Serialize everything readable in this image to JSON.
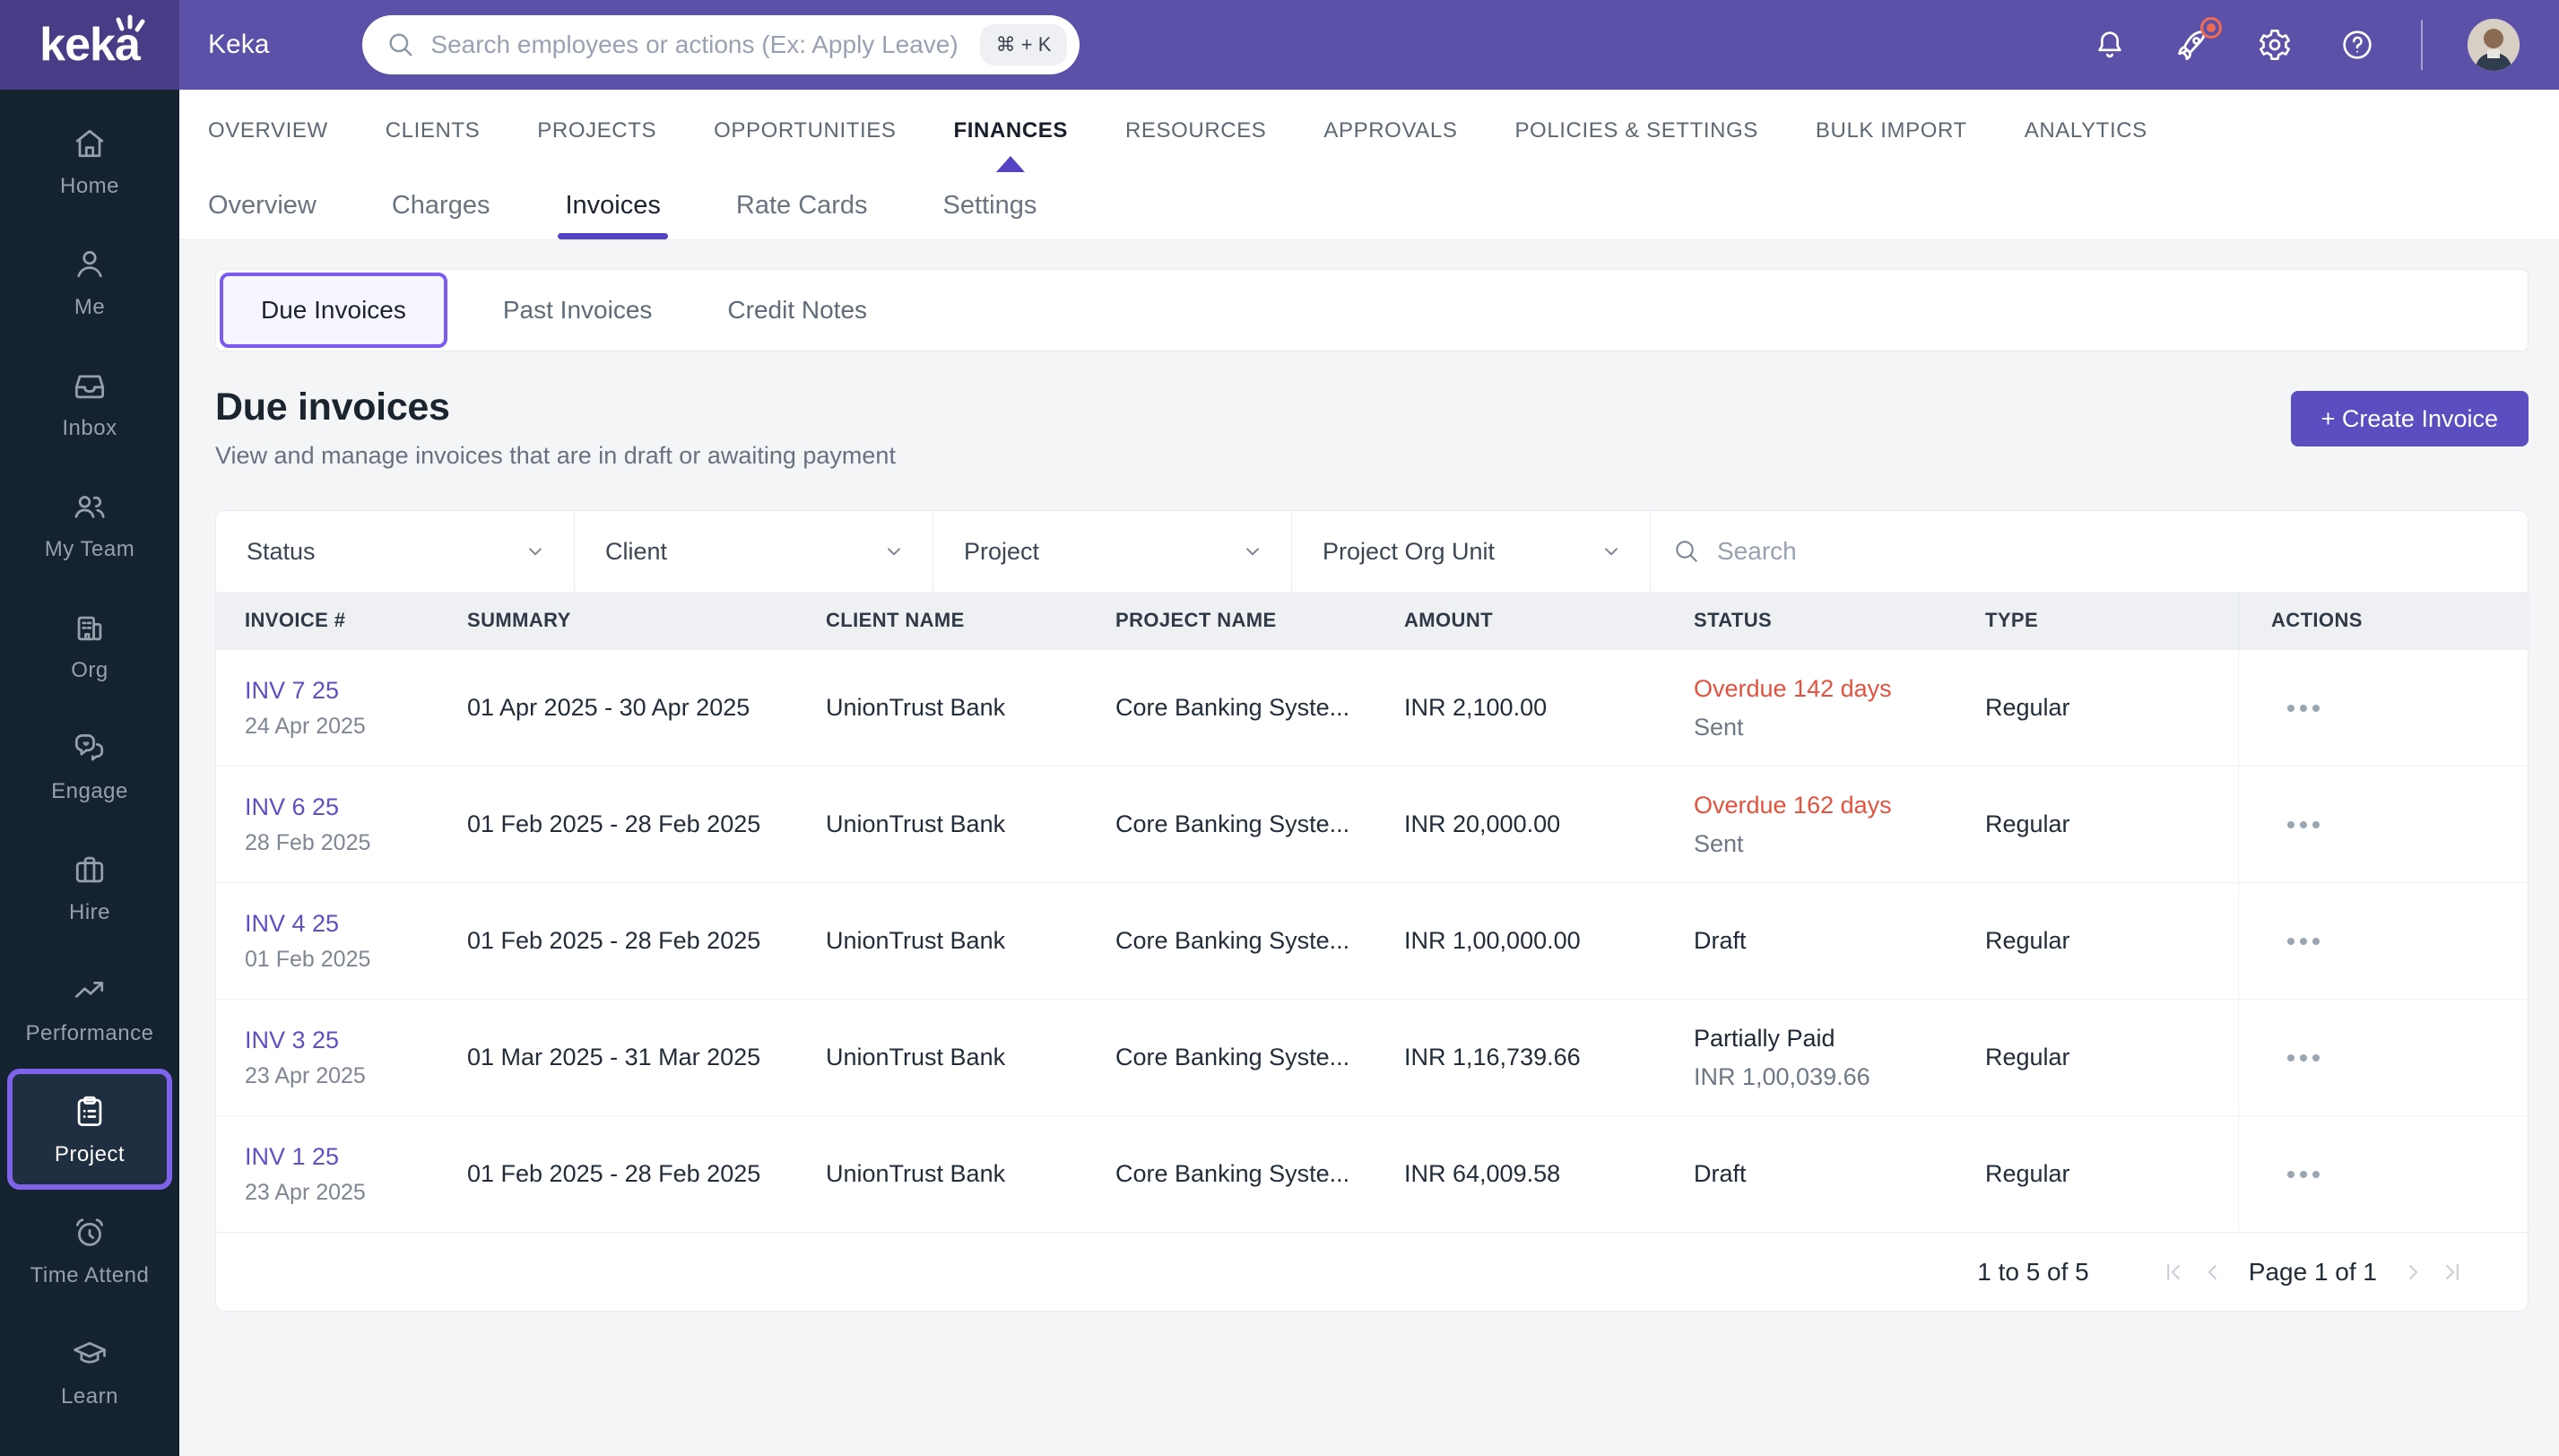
{
  "topbar": {
    "brand": "keka",
    "breadcrumb": "Keka",
    "search_placeholder": "Search employees or actions (Ex: Apply Leave)",
    "shortcut": "⌘ + K"
  },
  "sidebar": {
    "items": [
      {
        "label": "Home",
        "icon": "home-icon"
      },
      {
        "label": "Me",
        "icon": "person-icon"
      },
      {
        "label": "Inbox",
        "icon": "inbox-icon"
      },
      {
        "label": "My Team",
        "icon": "team-icon"
      },
      {
        "label": "Org",
        "icon": "org-building-icon"
      },
      {
        "label": "Engage",
        "icon": "engage-chat-icon"
      },
      {
        "label": "Hire",
        "icon": "briefcase-icon"
      },
      {
        "label": "Performance",
        "icon": "trend-icon"
      },
      {
        "label": "Project",
        "icon": "clipboard-icon",
        "active": true
      },
      {
        "label": "Time Attend",
        "icon": "alarm-clock-icon"
      },
      {
        "label": "Learn",
        "icon": "graduation-cap-icon"
      }
    ]
  },
  "main_nav": {
    "tabs": [
      "OVERVIEW",
      "CLIENTS",
      "PROJECTS",
      "OPPORTUNITIES",
      "FINANCES",
      "RESOURCES",
      "APPROVALS",
      "POLICIES & SETTINGS",
      "BULK IMPORT",
      "ANALYTICS"
    ],
    "active": "FINANCES"
  },
  "sub_nav": {
    "tabs": [
      "Overview",
      "Charges",
      "Invoices",
      "Rate Cards",
      "Settings"
    ],
    "active": "Invoices"
  },
  "invoice_tabs": {
    "tabs": [
      "Due Invoices",
      "Past Invoices",
      "Credit Notes"
    ],
    "active": "Due Invoices"
  },
  "page": {
    "title": "Due invoices",
    "subtitle": "View and manage invoices that are in draft or awaiting payment",
    "create_button": "+ Create Invoice"
  },
  "filters": {
    "dropdowns": [
      "Status",
      "Client",
      "Project",
      "Project Org Unit"
    ],
    "search_placeholder": "Search"
  },
  "table": {
    "columns": [
      "INVOICE #",
      "SUMMARY",
      "CLIENT NAME",
      "PROJECT NAME",
      "AMOUNT",
      "STATUS",
      "TYPE",
      "ACTIONS"
    ],
    "rows": [
      {
        "invoice": "INV 7 25",
        "date": "24 Apr 2025",
        "summary": "01 Apr 2025 - 30 Apr 2025",
        "client": "UnionTrust Bank",
        "project": "Core Banking Syste...",
        "amount": "INR 2,100.00",
        "status": "Overdue 142 days",
        "status_color": "red",
        "status_sub": "Sent",
        "type": "Regular"
      },
      {
        "invoice": "INV 6 25",
        "date": "28 Feb 2025",
        "summary": "01 Feb 2025 - 28 Feb 2025",
        "client": "UnionTrust Bank",
        "project": "Core Banking Syste...",
        "amount": "INR 20,000.00",
        "status": "Overdue 162 days",
        "status_color": "red",
        "status_sub": "Sent",
        "type": "Regular"
      },
      {
        "invoice": "INV 4 25",
        "date": "01 Feb 2025",
        "summary": "01 Feb 2025 - 28 Feb 2025",
        "client": "UnionTrust Bank",
        "project": "Core Banking Syste...",
        "amount": "INR 1,00,000.00",
        "status": "Draft",
        "status_color": "dark",
        "status_sub": "",
        "type": "Regular"
      },
      {
        "invoice": "INV 3 25",
        "date": "23 Apr 2025",
        "summary": "01 Mar 2025 - 31 Mar 2025",
        "client": "UnionTrust Bank",
        "project": "Core Banking Syste...",
        "amount": "INR 1,16,739.66",
        "status": "Partially Paid",
        "status_color": "dark",
        "status_sub": "INR 1,00,039.66",
        "type": "Regular"
      },
      {
        "invoice": "INV 1 25",
        "date": "23 Apr 2025",
        "summary": "01 Feb 2025 - 28 Feb 2025",
        "client": "UnionTrust Bank",
        "project": "Core Banking Syste...",
        "amount": "INR 64,009.58",
        "status": "Draft",
        "status_color": "dark",
        "status_sub": "",
        "type": "Regular"
      }
    ]
  },
  "pagination": {
    "range": "1 to 5 of 5",
    "page": "Page 1 of 1"
  },
  "colors": {
    "topbar": "#5b51a8",
    "logo_block": "#473c85",
    "sidebar": "#152230",
    "accent_purple": "#5443c2",
    "focus_purple": "#7c5cf0",
    "button_purple": "#5a4ec0",
    "link_purple": "#5b51c4",
    "overdue_red": "#e4523d",
    "badge_red": "#ee6a52",
    "header_bg": "#eef0f3",
    "page_bg": "#f4f5f6"
  }
}
